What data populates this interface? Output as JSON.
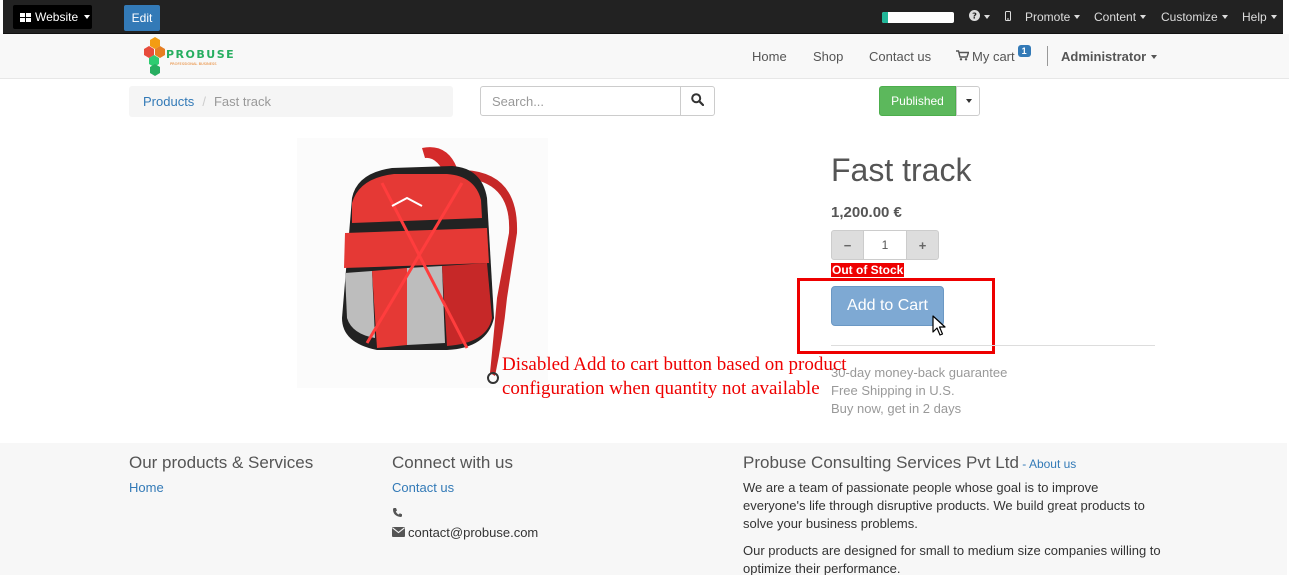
{
  "topbar": {
    "website_label": "Website",
    "edit_label": "Edit",
    "progress_fraction": 0.08,
    "help_icon": "question-circle-icon",
    "mobile_icon": "mobile-icon",
    "promote_label": "Promote",
    "content_label": "Content",
    "customize_label": "Customize",
    "help_label": "Help"
  },
  "navbar": {
    "logo_text": "PROBUSE",
    "logo_tagline": "PROFESSIONAL BUSINESS",
    "home_label": "Home",
    "shop_label": "Shop",
    "contact_label": "Contact us",
    "cart_label": "My cart",
    "cart_count": "1",
    "user_label": "Administrator"
  },
  "breadcrumb": {
    "parent_label": "Products",
    "separator": "/",
    "current_label": "Fast track"
  },
  "search": {
    "placeholder": "Search..."
  },
  "publish": {
    "label": "Published"
  },
  "product": {
    "name": "Fast track",
    "price": "1,200.00 €",
    "minus_label": "−",
    "plus_label": "+",
    "quantity": "1",
    "stock_status": "Out of Stock",
    "add_to_cart_label": "Add to Cart",
    "guarantees": [
      "30-day money-back guarantee",
      "Free Shipping in U.S.",
      "Buy now, get in 2 days"
    ]
  },
  "annotation": {
    "text": "Disabled Add to cart button based on product configuration when quantity not available"
  },
  "footer": {
    "col1_title": "Our products & Services",
    "col1_link": "Home",
    "col2_title": "Connect with us",
    "col2_link": "Contact us",
    "email": "contact@probuse.com",
    "col3_title": "Probuse Consulting Services Pvt Ltd",
    "col3_about_sep": " - ",
    "col3_about": "About us",
    "para1": "We are a team of passionate people whose goal is to improve everyone's life through disruptive products. We build great products to solve your business problems.",
    "para2": "Our products are designed for small to medium size companies willing to optimize their performance."
  },
  "colors": {
    "accent": "#337ab7",
    "published_green": "#5cb85c",
    "alert_red": "#ee0000"
  }
}
